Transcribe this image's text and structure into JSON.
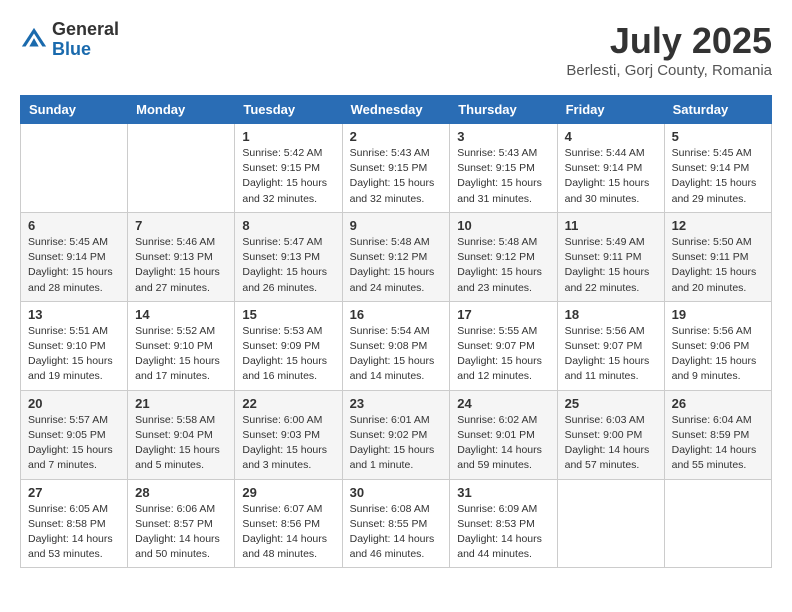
{
  "header": {
    "logo_general": "General",
    "logo_blue": "Blue",
    "month_year": "July 2025",
    "location": "Berlesti, Gorj County, Romania"
  },
  "days_of_week": [
    "Sunday",
    "Monday",
    "Tuesday",
    "Wednesday",
    "Thursday",
    "Friday",
    "Saturday"
  ],
  "weeks": [
    [
      {
        "day": "",
        "sunrise": "",
        "sunset": "",
        "daylight": ""
      },
      {
        "day": "",
        "sunrise": "",
        "sunset": "",
        "daylight": ""
      },
      {
        "day": "1",
        "sunrise": "Sunrise: 5:42 AM",
        "sunset": "Sunset: 9:15 PM",
        "daylight": "Daylight: 15 hours and 32 minutes."
      },
      {
        "day": "2",
        "sunrise": "Sunrise: 5:43 AM",
        "sunset": "Sunset: 9:15 PM",
        "daylight": "Daylight: 15 hours and 32 minutes."
      },
      {
        "day": "3",
        "sunrise": "Sunrise: 5:43 AM",
        "sunset": "Sunset: 9:15 PM",
        "daylight": "Daylight: 15 hours and 31 minutes."
      },
      {
        "day": "4",
        "sunrise": "Sunrise: 5:44 AM",
        "sunset": "Sunset: 9:14 PM",
        "daylight": "Daylight: 15 hours and 30 minutes."
      },
      {
        "day": "5",
        "sunrise": "Sunrise: 5:45 AM",
        "sunset": "Sunset: 9:14 PM",
        "daylight": "Daylight: 15 hours and 29 minutes."
      }
    ],
    [
      {
        "day": "6",
        "sunrise": "Sunrise: 5:45 AM",
        "sunset": "Sunset: 9:14 PM",
        "daylight": "Daylight: 15 hours and 28 minutes."
      },
      {
        "day": "7",
        "sunrise": "Sunrise: 5:46 AM",
        "sunset": "Sunset: 9:13 PM",
        "daylight": "Daylight: 15 hours and 27 minutes."
      },
      {
        "day": "8",
        "sunrise": "Sunrise: 5:47 AM",
        "sunset": "Sunset: 9:13 PM",
        "daylight": "Daylight: 15 hours and 26 minutes."
      },
      {
        "day": "9",
        "sunrise": "Sunrise: 5:48 AM",
        "sunset": "Sunset: 9:12 PM",
        "daylight": "Daylight: 15 hours and 24 minutes."
      },
      {
        "day": "10",
        "sunrise": "Sunrise: 5:48 AM",
        "sunset": "Sunset: 9:12 PM",
        "daylight": "Daylight: 15 hours and 23 minutes."
      },
      {
        "day": "11",
        "sunrise": "Sunrise: 5:49 AM",
        "sunset": "Sunset: 9:11 PM",
        "daylight": "Daylight: 15 hours and 22 minutes."
      },
      {
        "day": "12",
        "sunrise": "Sunrise: 5:50 AM",
        "sunset": "Sunset: 9:11 PM",
        "daylight": "Daylight: 15 hours and 20 minutes."
      }
    ],
    [
      {
        "day": "13",
        "sunrise": "Sunrise: 5:51 AM",
        "sunset": "Sunset: 9:10 PM",
        "daylight": "Daylight: 15 hours and 19 minutes."
      },
      {
        "day": "14",
        "sunrise": "Sunrise: 5:52 AM",
        "sunset": "Sunset: 9:10 PM",
        "daylight": "Daylight: 15 hours and 17 minutes."
      },
      {
        "day": "15",
        "sunrise": "Sunrise: 5:53 AM",
        "sunset": "Sunset: 9:09 PM",
        "daylight": "Daylight: 15 hours and 16 minutes."
      },
      {
        "day": "16",
        "sunrise": "Sunrise: 5:54 AM",
        "sunset": "Sunset: 9:08 PM",
        "daylight": "Daylight: 15 hours and 14 minutes."
      },
      {
        "day": "17",
        "sunrise": "Sunrise: 5:55 AM",
        "sunset": "Sunset: 9:07 PM",
        "daylight": "Daylight: 15 hours and 12 minutes."
      },
      {
        "day": "18",
        "sunrise": "Sunrise: 5:56 AM",
        "sunset": "Sunset: 9:07 PM",
        "daylight": "Daylight: 15 hours and 11 minutes."
      },
      {
        "day": "19",
        "sunrise": "Sunrise: 5:56 AM",
        "sunset": "Sunset: 9:06 PM",
        "daylight": "Daylight: 15 hours and 9 minutes."
      }
    ],
    [
      {
        "day": "20",
        "sunrise": "Sunrise: 5:57 AM",
        "sunset": "Sunset: 9:05 PM",
        "daylight": "Daylight: 15 hours and 7 minutes."
      },
      {
        "day": "21",
        "sunrise": "Sunrise: 5:58 AM",
        "sunset": "Sunset: 9:04 PM",
        "daylight": "Daylight: 15 hours and 5 minutes."
      },
      {
        "day": "22",
        "sunrise": "Sunrise: 6:00 AM",
        "sunset": "Sunset: 9:03 PM",
        "daylight": "Daylight: 15 hours and 3 minutes."
      },
      {
        "day": "23",
        "sunrise": "Sunrise: 6:01 AM",
        "sunset": "Sunset: 9:02 PM",
        "daylight": "Daylight: 15 hours and 1 minute."
      },
      {
        "day": "24",
        "sunrise": "Sunrise: 6:02 AM",
        "sunset": "Sunset: 9:01 PM",
        "daylight": "Daylight: 14 hours and 59 minutes."
      },
      {
        "day": "25",
        "sunrise": "Sunrise: 6:03 AM",
        "sunset": "Sunset: 9:00 PM",
        "daylight": "Daylight: 14 hours and 57 minutes."
      },
      {
        "day": "26",
        "sunrise": "Sunrise: 6:04 AM",
        "sunset": "Sunset: 8:59 PM",
        "daylight": "Daylight: 14 hours and 55 minutes."
      }
    ],
    [
      {
        "day": "27",
        "sunrise": "Sunrise: 6:05 AM",
        "sunset": "Sunset: 8:58 PM",
        "daylight": "Daylight: 14 hours and 53 minutes."
      },
      {
        "day": "28",
        "sunrise": "Sunrise: 6:06 AM",
        "sunset": "Sunset: 8:57 PM",
        "daylight": "Daylight: 14 hours and 50 minutes."
      },
      {
        "day": "29",
        "sunrise": "Sunrise: 6:07 AM",
        "sunset": "Sunset: 8:56 PM",
        "daylight": "Daylight: 14 hours and 48 minutes."
      },
      {
        "day": "30",
        "sunrise": "Sunrise: 6:08 AM",
        "sunset": "Sunset: 8:55 PM",
        "daylight": "Daylight: 14 hours and 46 minutes."
      },
      {
        "day": "31",
        "sunrise": "Sunrise: 6:09 AM",
        "sunset": "Sunset: 8:53 PM",
        "daylight": "Daylight: 14 hours and 44 minutes."
      },
      {
        "day": "",
        "sunrise": "",
        "sunset": "",
        "daylight": ""
      },
      {
        "day": "",
        "sunrise": "",
        "sunset": "",
        "daylight": ""
      }
    ]
  ]
}
